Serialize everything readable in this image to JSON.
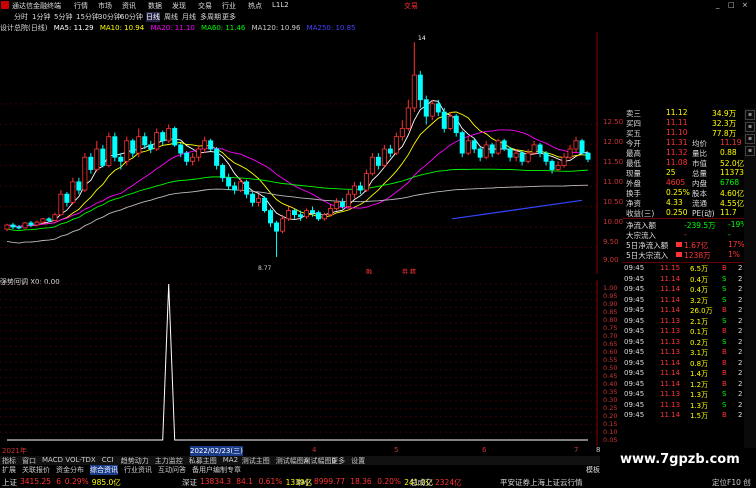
{
  "topbar": {
    "app_name": "通达信金融终端",
    "menus": [
      "行情",
      "市场",
      "资讯",
      "数据",
      "发现",
      "交易",
      "行业",
      "热点",
      "L1L2"
    ],
    "trade_label": "交易",
    "window_controls": [
      "_",
      "□",
      "×"
    ]
  },
  "periods": [
    "分时",
    "1分钟",
    "5分钟",
    "15分钟",
    "30分钟",
    "60分钟",
    "日线",
    "周线",
    "月线",
    "多周期",
    "更多"
  ],
  "active_period": "日线",
  "ma_legend": {
    "title": "设计总院(日线)",
    "items": [
      {
        "label": "MA5: 11.29",
        "color": "#ffffff"
      },
      {
        "label": "MA10: 10.94",
        "color": "#ffff00"
      },
      {
        "label": "MA20: 11.10",
        "color": "#ff00ff"
      },
      {
        "label": "MA60: 11.46",
        "color": "#00ff00"
      },
      {
        "label": "MA120: 10.96",
        "color": "#cccccc"
      },
      {
        "label": "MA250: 10.85",
        "color": "#4444ff"
      }
    ]
  },
  "main_axis": [
    "12.50",
    "12.00",
    "11.50",
    "11.00",
    "10.50",
    "10.00",
    "9.50",
    "9.00"
  ],
  "annotations": {
    "high": "14",
    "low": "8.77",
    "mark1": "融",
    "mark2": "券 精"
  },
  "ind_title": "强势回调  X0: 0.00",
  "ind_axis": [
    "1.00",
    "0.95",
    "0.90",
    "0.85",
    "0.80",
    "0.75",
    "0.70",
    "0.65",
    "0.60",
    "0.55",
    "0.50",
    "0.45",
    "0.40",
    "0.35",
    "0.30",
    "0.25",
    "0.20",
    "0.15",
    "0.10",
    "0.05"
  ],
  "date_axis": {
    "left": "2021年",
    "cursor": "2022/02/23(三)",
    "marks": [
      "4",
      "5",
      "6",
      "7"
    ],
    "right": "8"
  },
  "quote_panel": [
    {
      "k": "卖三",
      "v": "11.12",
      "c": "#ffff00",
      "k2": "",
      "v2": "34.9万",
      "c2": "#ffff00"
    },
    {
      "k": "买四",
      "v": "11.11",
      "c": "#ff3333",
      "k2": "",
      "v2": "32.3万",
      "c2": "#ffff00"
    },
    {
      "k": "买五",
      "v": "11.10",
      "c": "#ff3333",
      "k2": "",
      "v2": "77.8万",
      "c2": "#ffff00"
    },
    {
      "k": "今开",
      "v": "11.31",
      "c": "#ff3333",
      "k2": "均价",
      "v2": "11.19",
      "c2": "#ff3333"
    },
    {
      "k": "最高",
      "v": "11.32",
      "c": "#ff3333",
      "k2": "量比",
      "v2": "0.88",
      "c2": "#ffff00"
    },
    {
      "k": "最低",
      "v": "11.08",
      "c": "#ff3333",
      "k2": "市值",
      "v2": "52.0亿",
      "c2": "#ffff00"
    },
    {
      "k": "现量",
      "v": "25",
      "c": "#ffff00",
      "k2": "总量",
      "v2": "11373",
      "c2": "#ffff00"
    },
    {
      "k": "外盘",
      "v": "4605",
      "c": "#ff3333",
      "k2": "内盘",
      "v2": "6768",
      "c2": "#00ff00"
    },
    {
      "k": "换手",
      "v": "0.25%",
      "c": "#ffff00",
      "k2": "股本",
      "v2": "4.60亿",
      "c2": "#ffff00"
    },
    {
      "k": "净资",
      "v": "4.33",
      "c": "#ffff00",
      "k2": "流通",
      "v2": "4.55亿",
      "c2": "#ffff00"
    },
    {
      "k": "收益(三)",
      "v": "0.250",
      "c": "#ffff00",
      "k2": "PE(动)",
      "v2": "11.7",
      "c2": "#ffff00"
    }
  ],
  "flow_panel": [
    {
      "k": "净流入额",
      "v": "-239.5万",
      "p": "-19%"
    },
    {
      "k": "大宗流入",
      "v": "-",
      "p": "-"
    },
    {
      "k": "5日净流入额",
      "v": "1.67亿",
      "p": "17%"
    },
    {
      "k": "5日大宗流入",
      "v": "1238万",
      "p": "1%"
    }
  ],
  "ticks": [
    [
      "09:45",
      "11.15",
      "6.5万",
      "B",
      "2"
    ],
    [
      "09:45",
      "11.14",
      "0.4万",
      "S",
      "2"
    ],
    [
      "09:45",
      "11.14",
      "0.4万",
      "S",
      "2"
    ],
    [
      "09:45",
      "11.14",
      "3.2万",
      "S",
      "2"
    ],
    [
      "09:45",
      "11.14",
      "26.0万",
      "B",
      "2"
    ],
    [
      "09:45",
      "11.13",
      "2.1万",
      "S",
      "2"
    ],
    [
      "09:45",
      "11.13",
      "0.1万",
      "B",
      "2"
    ],
    [
      "09:45",
      "11.13",
      "0.2万",
      "S",
      "2"
    ],
    [
      "09:45",
      "11.13",
      "3.1万",
      "B",
      "2"
    ],
    [
      "09:45",
      "11.14",
      "0.8万",
      "B",
      "2"
    ],
    [
      "09:45",
      "11.14",
      "1.4万",
      "B",
      "2"
    ],
    [
      "09:45",
      "11.14",
      "1.2万",
      "B",
      "2"
    ],
    [
      "09:45",
      "11.13",
      "1.3万",
      "S",
      "2"
    ],
    [
      "09:45",
      "11.13",
      "1.3万",
      "S",
      "2"
    ],
    [
      "09:45",
      "11.14",
      "1.5万",
      "B",
      "2"
    ]
  ],
  "bottom_tabs": [
    "指标",
    "窗口",
    "MACD",
    "VOL-TDX",
    "CCI",
    "趋势动力",
    "主力监控",
    "私募主图",
    "MA2",
    "测试主图",
    "测试幅图A",
    "测试幅图B",
    "更多",
    "设置"
  ],
  "bottom_tabs2": [
    "扩展",
    "关联报价",
    "资金分布",
    "综合资讯",
    "行业资讯",
    "互动问答",
    "备用户编制专章"
  ],
  "tab_extra": "模板",
  "index_bar": [
    {
      "name": "上证",
      "val": "3415.25",
      "chg": "6",
      "pct": "0.29%",
      "amt": "985.0亿"
    },
    {
      "name": "深证",
      "val": "13834.3",
      "chg": "84.1",
      "pct": "0.61%",
      "amt": "1339亿"
    },
    {
      "name": "中小",
      "val": "8999.77",
      "chg": "18.36",
      "pct": "0.20%",
      "amt": "241.0亿"
    },
    {
      "name": "总成交",
      "val": "2324亿",
      "chg": "",
      "pct": "",
      "amt": ""
    }
  ],
  "news_ticker": "平安证券上海上证云行情",
  "status_right": "定位F10 创",
  "watermark": "www.7gpzb.com",
  "colors": {
    "up": "#ff3333",
    "down": "#00ffff",
    "ma5": "#ffffff",
    "ma10": "#ffff00",
    "ma20": "#ff00ff",
    "ma60": "#00ff00",
    "ma120": "#bbbbbb",
    "ma250": "#3344ff",
    "axis": "#cc2222"
  },
  "candles": [
    [
      9.45,
      9.55,
      9.4,
      9.58
    ],
    [
      9.55,
      9.5,
      9.45,
      9.6
    ],
    [
      9.5,
      9.48,
      9.44,
      9.55
    ],
    [
      9.48,
      9.6,
      9.46,
      9.62
    ],
    [
      9.6,
      9.55,
      9.5,
      9.65
    ],
    [
      9.55,
      9.62,
      9.52,
      9.66
    ],
    [
      9.62,
      9.7,
      9.58,
      9.72
    ],
    [
      9.7,
      9.66,
      9.62,
      9.74
    ],
    [
      9.66,
      9.8,
      9.64,
      9.85
    ],
    [
      9.8,
      10.3,
      9.78,
      10.4
    ],
    [
      10.3,
      10.1,
      10.0,
      10.35
    ],
    [
      10.1,
      10.6,
      10.05,
      10.7
    ],
    [
      10.6,
      10.4,
      10.3,
      10.7
    ],
    [
      10.4,
      11.2,
      10.35,
      11.3
    ],
    [
      11.2,
      10.9,
      10.8,
      11.3
    ],
    [
      10.9,
      11.4,
      10.85,
      11.6
    ],
    [
      11.4,
      11.0,
      10.95,
      11.5
    ],
    [
      11.0,
      11.7,
      10.95,
      11.8
    ],
    [
      11.7,
      11.2,
      11.1,
      11.8
    ],
    [
      11.2,
      11.1,
      10.9,
      11.3
    ],
    [
      11.1,
      11.6,
      11.0,
      11.7
    ],
    [
      11.6,
      11.3,
      11.2,
      11.65
    ],
    [
      11.3,
      11.7,
      11.2,
      11.9
    ],
    [
      11.7,
      11.5,
      11.4,
      11.8
    ],
    [
      11.5,
      11.4,
      11.3,
      11.6
    ],
    [
      11.4,
      11.8,
      11.35,
      11.9
    ],
    [
      11.8,
      11.6,
      11.5,
      11.85
    ],
    [
      11.6,
      11.9,
      11.55,
      12.0
    ],
    [
      11.9,
      11.5,
      11.45,
      11.95
    ],
    [
      11.5,
      11.3,
      11.2,
      11.55
    ],
    [
      11.3,
      11.1,
      11.0,
      11.35
    ],
    [
      11.1,
      11.2,
      11.0,
      11.3
    ],
    [
      11.2,
      11.4,
      11.1,
      11.5
    ],
    [
      11.4,
      11.6,
      11.3,
      11.7
    ],
    [
      11.6,
      11.4,
      11.35,
      11.65
    ],
    [
      11.4,
      11.0,
      10.9,
      11.45
    ],
    [
      11.0,
      10.7,
      10.6,
      11.05
    ],
    [
      10.7,
      10.5,
      10.4,
      10.8
    ],
    [
      10.5,
      10.4,
      10.3,
      10.6
    ],
    [
      10.4,
      10.6,
      10.35,
      10.7
    ],
    [
      10.6,
      10.3,
      10.2,
      10.65
    ],
    [
      10.3,
      10.1,
      10.0,
      10.35
    ],
    [
      10.1,
      10.2,
      10.0,
      10.3
    ],
    [
      10.2,
      9.9,
      9.85,
      10.25
    ],
    [
      9.9,
      9.6,
      9.5,
      9.95
    ],
    [
      9.6,
      9.4,
      8.77,
      9.65
    ],
    [
      9.4,
      9.7,
      9.35,
      9.8
    ],
    [
      9.7,
      9.9,
      9.65,
      10.0
    ],
    [
      9.9,
      9.8,
      9.7,
      9.95
    ],
    [
      9.8,
      9.75,
      9.65,
      9.9
    ],
    [
      9.75,
      9.9,
      9.7,
      9.95
    ],
    [
      9.9,
      9.85,
      9.75,
      10.0
    ],
    [
      9.85,
      9.7,
      9.65,
      9.9
    ],
    [
      9.7,
      9.8,
      9.65,
      9.85
    ],
    [
      9.8,
      9.95,
      9.75,
      10.05
    ],
    [
      9.95,
      10.1,
      9.9,
      10.2
    ],
    [
      10.1,
      10.0,
      9.95,
      10.2
    ],
    [
      10.0,
      10.3,
      9.95,
      10.4
    ],
    [
      10.3,
      10.5,
      10.2,
      10.6
    ],
    [
      10.5,
      10.4,
      10.3,
      10.6
    ],
    [
      10.4,
      10.8,
      10.35,
      10.9
    ],
    [
      10.8,
      11.2,
      10.75,
      11.3
    ],
    [
      11.2,
      11.0,
      10.9,
      11.3
    ],
    [
      11.0,
      11.4,
      10.95,
      11.5
    ],
    [
      11.4,
      11.3,
      11.2,
      11.5
    ],
    [
      11.3,
      11.7,
      11.25,
      11.8
    ],
    [
      11.7,
      11.9,
      11.6,
      12.1
    ],
    [
      11.9,
      12.4,
      11.85,
      12.6
    ],
    [
      12.4,
      13.2,
      12.3,
      14.0
    ],
    [
      13.2,
      12.6,
      12.4,
      13.3
    ],
    [
      12.6,
      12.2,
      12.0,
      12.7
    ],
    [
      12.2,
      12.5,
      12.1,
      12.6
    ],
    [
      12.5,
      12.3,
      12.2,
      12.6
    ],
    [
      12.3,
      11.9,
      11.8,
      12.4
    ],
    [
      11.9,
      12.2,
      11.85,
      12.3
    ],
    [
      12.2,
      11.8,
      11.7,
      12.25
    ],
    [
      11.8,
      11.3,
      11.2,
      11.85
    ],
    [
      11.3,
      11.6,
      11.25,
      11.7
    ],
    [
      11.6,
      11.4,
      11.3,
      11.65
    ],
    [
      11.4,
      11.2,
      11.1,
      11.45
    ],
    [
      11.2,
      11.5,
      11.15,
      11.6
    ],
    [
      11.5,
      11.3,
      11.2,
      11.55
    ],
    [
      11.3,
      11.6,
      11.25,
      11.65
    ],
    [
      11.6,
      11.4,
      11.35,
      11.65
    ],
    [
      11.4,
      11.2,
      11.1,
      11.45
    ],
    [
      11.2,
      11.3,
      11.1,
      11.4
    ],
    [
      11.3,
      11.1,
      11.0,
      11.35
    ],
    [
      11.1,
      11.3,
      11.05,
      11.4
    ],
    [
      11.3,
      11.5,
      11.25,
      11.6
    ],
    [
      11.5,
      11.3,
      11.2,
      11.55
    ],
    [
      11.3,
      11.1,
      11.0,
      11.35
    ],
    [
      11.1,
      10.9,
      10.8,
      11.15
    ],
    [
      10.9,
      11.0,
      10.85,
      11.1
    ],
    [
      11.0,
      11.2,
      10.95,
      11.3
    ],
    [
      11.2,
      11.4,
      11.15,
      11.5
    ],
    [
      11.4,
      11.6,
      11.3,
      11.7
    ],
    [
      11.6,
      11.3,
      11.25,
      11.65
    ],
    [
      11.3,
      11.15,
      11.08,
      11.32
    ]
  ]
}
